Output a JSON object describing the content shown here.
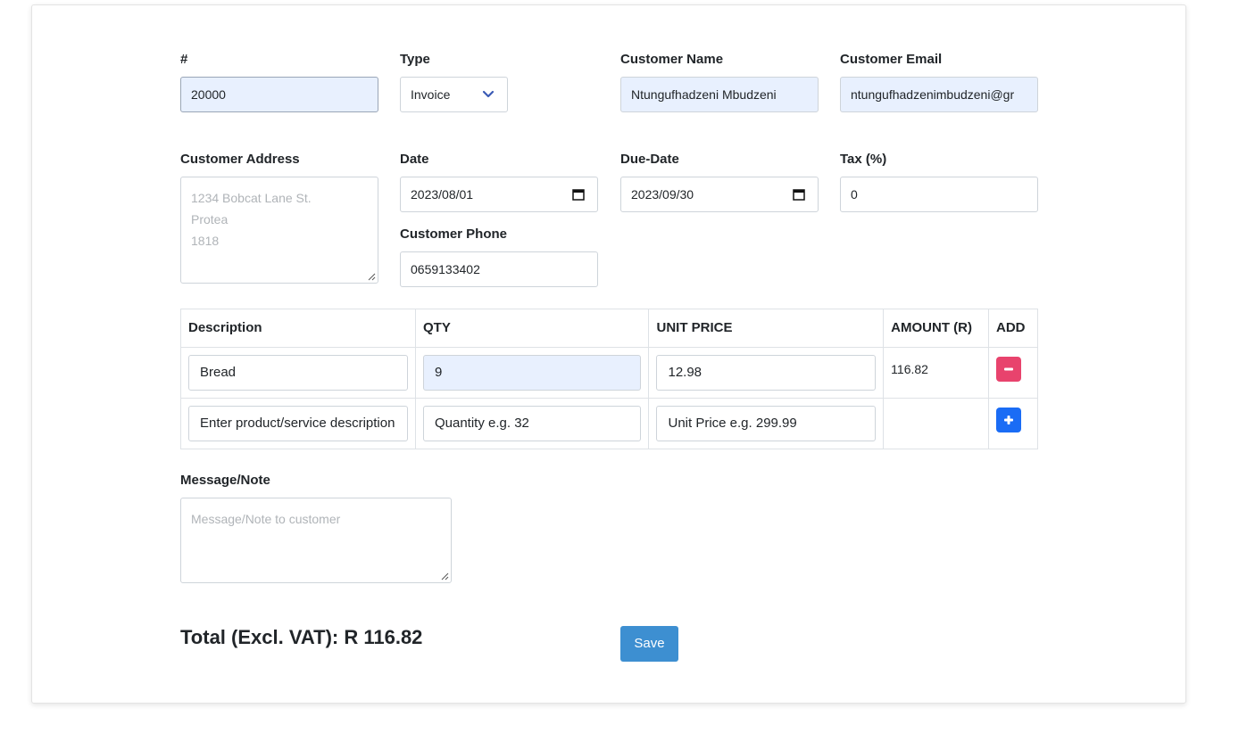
{
  "form": {
    "number": {
      "label": "#",
      "value": "20000"
    },
    "type": {
      "label": "Type",
      "value": "Invoice"
    },
    "customer_name": {
      "label": "Customer Name",
      "value": "Ntungufhadzeni Mbudzeni"
    },
    "customer_email": {
      "label": "Customer Email",
      "value": "ntungufhadzenimbudzeni@gr"
    },
    "customer_address": {
      "label": "Customer Address",
      "placeholder_lines": [
        "1234 Bobcat Lane St.",
        "Protea",
        "1818"
      ]
    },
    "date": {
      "label": "Date",
      "value": "2023/08/01"
    },
    "due_date": {
      "label": "Due-Date",
      "value": "2023/09/30"
    },
    "tax": {
      "label": "Tax (%)",
      "value": "0"
    },
    "customer_phone": {
      "label": "Customer Phone",
      "value": "0659133402"
    }
  },
  "items_table": {
    "headers": [
      "Description",
      "QTY",
      "UNIT PRICE",
      "AMOUNT (R)",
      "ADD"
    ],
    "rows": [
      {
        "description": "Bread",
        "qty": "9",
        "unit_price": "12.98",
        "amount": "116.82",
        "action": "remove"
      }
    ],
    "new_row": {
      "description_placeholder": "Enter product/service description",
      "qty_placeholder": "Quantity e.g. 32",
      "unit_price_placeholder": "Unit Price e.g. 299.99",
      "action": "add"
    }
  },
  "message": {
    "label": "Message/Note",
    "placeholder": "Message/Note to customer"
  },
  "total": {
    "text": "Total (Excl. VAT): R 116.82"
  },
  "save_button": {
    "label": "Save"
  },
  "colors": {
    "autofill": "#e8f0fe",
    "remove_button": "#e8436d",
    "add_button": "#1a6cf5",
    "save_button": "#3d8fd1"
  }
}
